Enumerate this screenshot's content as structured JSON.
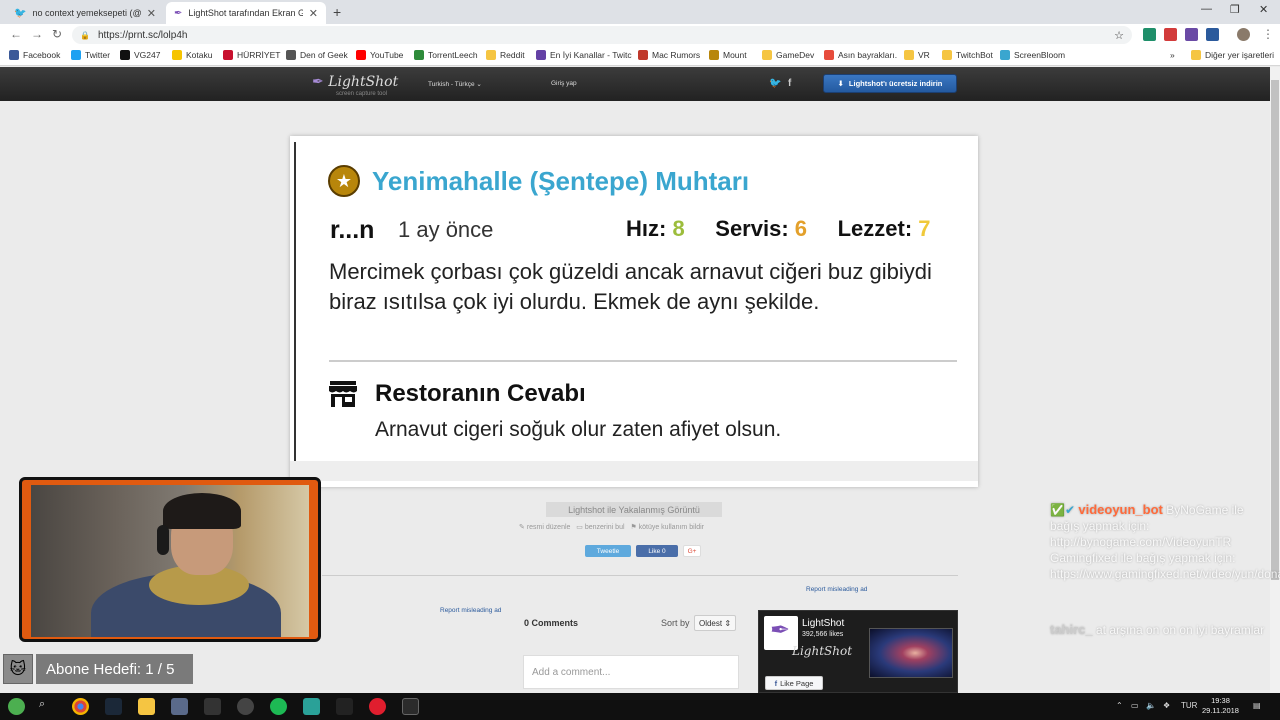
{
  "browser": {
    "tabs": [
      {
        "title": "no context yemeksepeti (@nocont",
        "active": false
      },
      {
        "title": "LightShot tarafından Ekran Görün",
        "active": true
      }
    ],
    "url": "https://prnt.sc/lolp4h"
  },
  "bookmarks": [
    {
      "label": "Facebook",
      "color": "#3b5998"
    },
    {
      "label": "Twitter",
      "color": "#1da1f2"
    },
    {
      "label": "VG247",
      "color": "#111111"
    },
    {
      "label": "Kotaku",
      "color": "#f6c400"
    },
    {
      "label": "HÜRRİYET",
      "color": "#c8102e"
    },
    {
      "label": "Den of Geek",
      "color": "#555555"
    },
    {
      "label": "YouTube",
      "color": "#ff0000"
    },
    {
      "label": "TorrentLeech",
      "color": "#2e8b3a"
    },
    {
      "label": "Reddit",
      "color": "#f5c542"
    },
    {
      "label": "En İyi Kanallar - Twitc",
      "color": "#6441a5"
    },
    {
      "label": "Mac Rumors",
      "color": "#c0392b"
    },
    {
      "label": "Mount",
      "color": "#b8860b"
    },
    {
      "label": "GameDev",
      "color": "#f5c542"
    },
    {
      "label": "Asın bayrakları.",
      "color": "#e74c3c"
    },
    {
      "label": "VR",
      "color": "#f5c542"
    },
    {
      "label": "TwitchBot",
      "color": "#f5c542"
    },
    {
      "label": "ScreenBloom",
      "color": "#3aa6cf"
    }
  ],
  "bookmarks_other": "Diğer yer işaretleri",
  "lightshot": {
    "logo": "LightShot",
    "logo_sub": "screen capture tool",
    "language": "Turkish - Türkçe",
    "login": "Giriş yap",
    "download": "Lightshot'ı ücretsiz indirin"
  },
  "review": {
    "restaurant": "Yenimahalle (Şentepe) Muhtarı",
    "user": "r...n",
    "time_ago": "1 ay önce",
    "scores": [
      {
        "label": "Hız:",
        "value": "8"
      },
      {
        "label": "Servis:",
        "value": "6"
      },
      {
        "label": "Lezzet:",
        "value": "7"
      }
    ],
    "text": "Mercimek çorbası çok güzeldi ancak arnavut ciğeri buz gibiydi biraz ısıtılsa çok iyi olurdu. Ekmek de aynı şekilde.",
    "reply_title": "Restoranın Cevabı",
    "reply_text": "Arnavut cigeri soğuk olur zaten afiyet olsun."
  },
  "page": {
    "caption": "Lightshot ile Yakalanmış Görüntü",
    "actions": [
      "resmi düzenle",
      "benzerini bul",
      "kötüye kullanım bildir"
    ],
    "share": {
      "tweet": "Tweetle",
      "like": "Like 0",
      "gplus": "G+"
    },
    "report_ad": "Report misleading ad",
    "comments_count": "0 Comments",
    "sort_by": "Sort by",
    "sort_value": "Oldest",
    "add_comment_placeholder": "Add a comment..."
  },
  "facebook_widget": {
    "name": "LightShot",
    "likes": "392,566 likes",
    "brand": "LightShot",
    "like_page": "Like Page"
  },
  "stream": {
    "sub_goal": "Abone Hedefi: 1 / 5",
    "chat": [
      {
        "name": "videoyun_bot",
        "name_color": "#ff6a3a",
        "text": "ByNoGame ile bağış yapmak için: http://bynogame.com/VideoyunTR Gamingfixed ile bağış yapmak için: https://www.gamingfixed.net/video/yun/donate"
      },
      {
        "name": "tahirc_",
        "name_color": "#cccccc",
        "text": "at arşına on on on iyi bayramlar"
      }
    ]
  },
  "taskbar": {
    "lang": "TUR",
    "time": "19:38",
    "date": "29.11.2018"
  }
}
